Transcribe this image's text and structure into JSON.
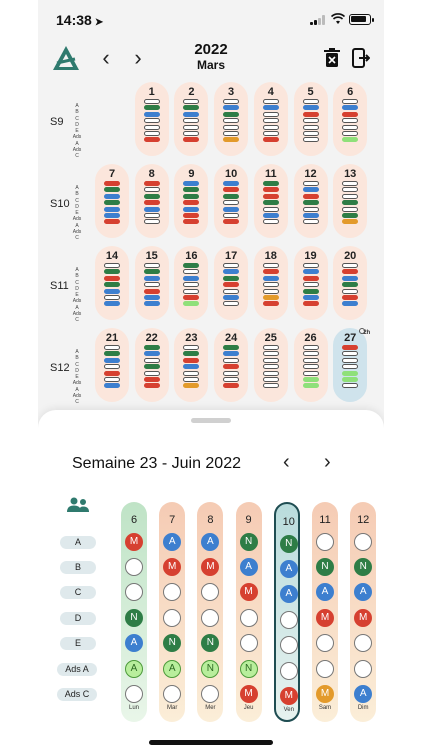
{
  "status_bar": {
    "time": "14:38"
  },
  "header": {
    "year": "2022",
    "month": "Mars",
    "prev": "‹",
    "next": "›"
  },
  "month_grid": {
    "row_letters": [
      "A",
      "B",
      "C",
      "D",
      "E",
      "Ads A",
      "Ads C"
    ],
    "weeks": [
      {
        "label": "S9",
        "days": [
          {
            "num": "1",
            "bars": "wgbwwwr"
          },
          {
            "num": "2",
            "bars": "wgbwwwr"
          },
          {
            "num": "3",
            "bars": "wbgwwwo"
          },
          {
            "num": "4",
            "bars": "wbwwwwr"
          },
          {
            "num": "5",
            "bars": "wbrwwww"
          },
          {
            "num": "6",
            "bars": "wbrwwwl"
          }
        ]
      },
      {
        "label": "S10",
        "days": [
          {
            "num": "7",
            "bars": "rgbgbbr"
          },
          {
            "num": "8",
            "bars": "rwgrbww"
          },
          {
            "num": "9",
            "bars": "bggrbrr"
          },
          {
            "num": "10",
            "bars": "brgwbwr"
          },
          {
            "num": "11",
            "bars": "grrgwbw"
          },
          {
            "num": "12",
            "bars": "wbrgwbw"
          },
          {
            "num": "13",
            "bars": "wwwgwgo"
          }
        ]
      },
      {
        "label": "S11",
        "days": [
          {
            "num": "14",
            "bars": "wgrgbwb"
          },
          {
            "num": "15",
            "bars": "wgbwrbb"
          },
          {
            "num": "16",
            "bars": "gwbwwrl"
          },
          {
            "num": "17",
            "bars": "wbgrwbw"
          },
          {
            "num": "18",
            "bars": "wrbwwor"
          },
          {
            "num": "19",
            "bars": "wbrwgbr"
          },
          {
            "num": "20",
            "bars": "wrbgwrb"
          }
        ]
      },
      {
        "label": "S12",
        "days": [
          {
            "num": "21",
            "bars": "wgbwrwb"
          },
          {
            "num": "22",
            "bars": "gbwgwrr"
          },
          {
            "num": "23",
            "bars": "wgrbwwo"
          },
          {
            "num": "24",
            "bars": "gbwrwwr"
          },
          {
            "num": "25",
            "bars": "wwwwwww"
          },
          {
            "num": "26",
            "bars": "wwwwwll"
          },
          {
            "num": "27",
            "bars": "rwwwllw",
            "badge": "2h"
          }
        ]
      }
    ]
  },
  "week_panel": {
    "title": "Semaine 23 - Juin 2022",
    "row_labels": [
      "A",
      "B",
      "C",
      "D",
      "E",
      "Ads A",
      "Ads C"
    ],
    "columns": [
      {
        "num": "6",
        "day": "Lun",
        "cells": [
          "M",
          "",
          "",
          "N",
          "A",
          "Al",
          ""
        ]
      },
      {
        "num": "7",
        "day": "Mar",
        "cells": [
          "A",
          "M",
          "",
          "",
          "N",
          "Al",
          ""
        ]
      },
      {
        "num": "8",
        "day": "Mer",
        "cells": [
          "A",
          "M",
          "",
          "",
          "N",
          "Nl",
          ""
        ]
      },
      {
        "num": "9",
        "day": "Jeu",
        "cells": [
          "N",
          "A",
          "M",
          "",
          "",
          "Nl",
          "M"
        ]
      },
      {
        "num": "10",
        "day": "Ven",
        "cells": [
          "N",
          "A",
          "A",
          "",
          "",
          "",
          "M"
        ]
      },
      {
        "num": "11",
        "day": "Sam",
        "cells": [
          "",
          "N",
          "A",
          "M",
          "",
          "",
          "Mo"
        ]
      },
      {
        "num": "12",
        "day": "Dim",
        "cells": [
          "",
          "N",
          "A",
          "M",
          "",
          "",
          "A"
        ]
      }
    ]
  }
}
